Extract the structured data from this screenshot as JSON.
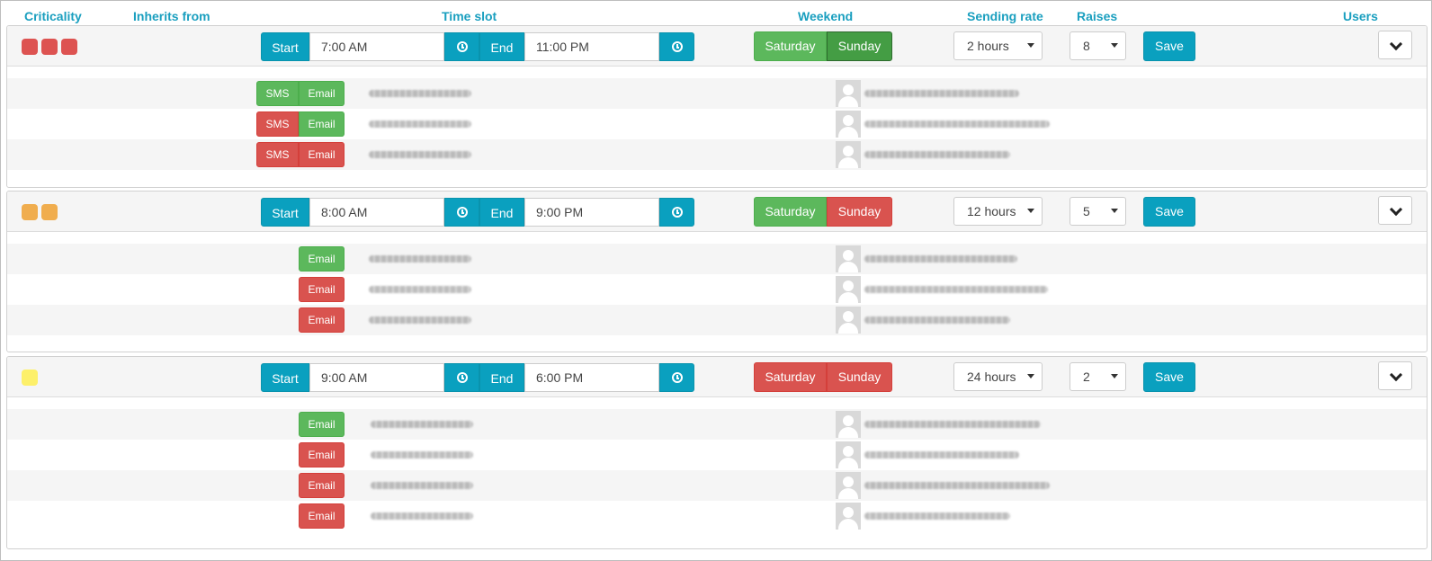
{
  "headers": {
    "criticality": "Criticality",
    "inherits_from": "Inherits from",
    "time_slot": "Time slot",
    "weekend": "Weekend",
    "sending_rate": "Sending rate",
    "raises": "Raises",
    "users": "Users"
  },
  "labels": {
    "start": "Start",
    "end": "End",
    "saturday": "Saturday",
    "sunday": "Sunday",
    "save": "Save",
    "sms": "SMS",
    "email": "Email"
  },
  "colors": {
    "accent": "#0aa0bf",
    "enabled": "#5cb85c",
    "active": "#449d44",
    "disabled": "#d9534f",
    "critical": "#dd5351",
    "warning": "#f0ad4e",
    "low": "#fdf06a"
  },
  "icons": {
    "clock": "clock-icon",
    "toggle": "chevron-down-icon",
    "avatar": "user-avatar-icon"
  },
  "groups": [
    {
      "criticality_level": 3,
      "criticality_color": "red",
      "start_time": "7:00 AM",
      "end_time": "11:00 PM",
      "saturday": "on",
      "sunday": "on-active",
      "sending_rate": "2 hours",
      "raises": "8",
      "users": [
        {
          "sms": "on",
          "email": "on"
        },
        {
          "sms": "off",
          "email": "on"
        },
        {
          "sms": "off",
          "email": "off"
        }
      ]
    },
    {
      "criticality_level": 2,
      "criticality_color": "orange",
      "start_time": "8:00 AM",
      "end_time": "9:00 PM",
      "saturday": "on",
      "sunday": "off",
      "sending_rate": "12 hours",
      "raises": "5",
      "users": [
        {
          "email": "on"
        },
        {
          "email": "off"
        },
        {
          "email": "off"
        }
      ]
    },
    {
      "criticality_level": 1,
      "criticality_color": "yellow",
      "start_time": "9:00 AM",
      "end_time": "6:00 PM",
      "saturday": "off",
      "sunday": "off",
      "sending_rate": "24 hours",
      "raises": "2",
      "users": [
        {
          "email": "on"
        },
        {
          "email": "off"
        },
        {
          "email": "off"
        },
        {
          "email": "off"
        }
      ]
    }
  ]
}
